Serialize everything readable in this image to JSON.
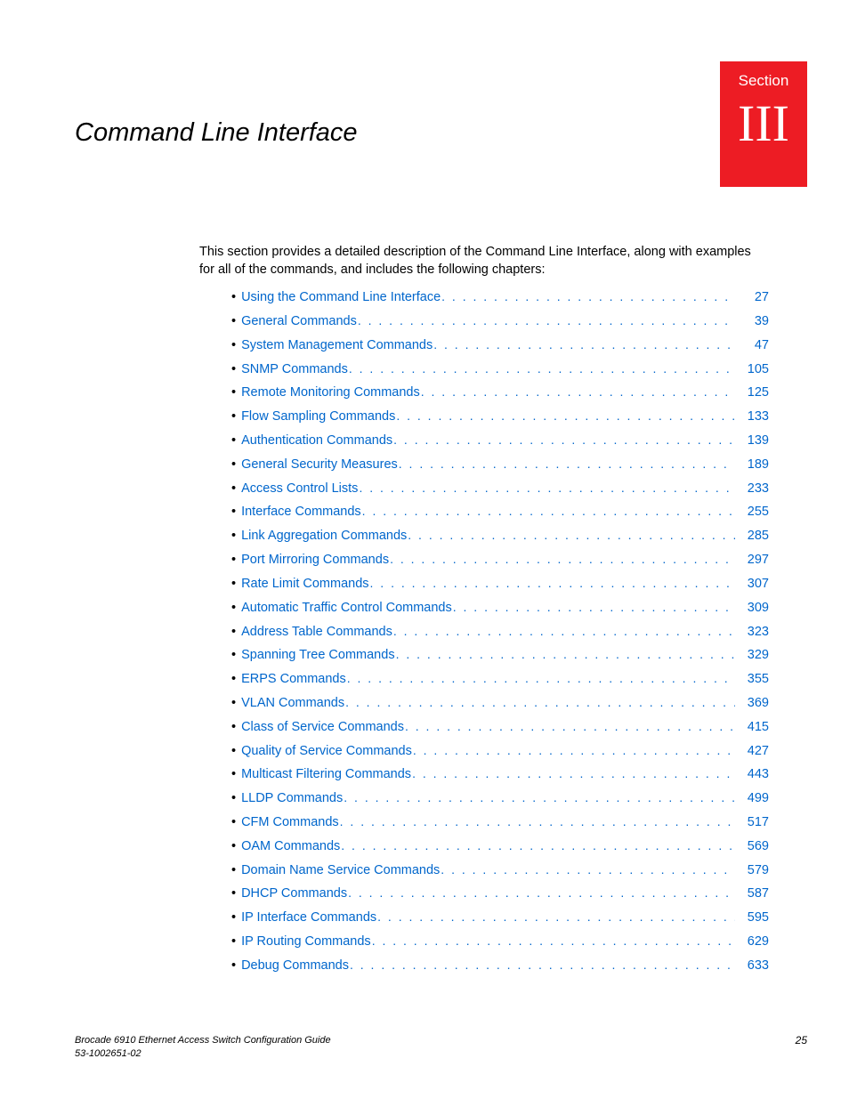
{
  "section": {
    "label": "Section",
    "number": "III"
  },
  "title": "Command Line Interface",
  "intro": "This section provides a detailed description of the Command Line Interface, along with examples for all of the commands, and includes the following chapters:",
  "toc": [
    {
      "label": "Using the Command Line Interface",
      "page": "27"
    },
    {
      "label": "General Commands",
      "page": "39"
    },
    {
      "label": "System Management Commands",
      "page": "47"
    },
    {
      "label": "SNMP Commands",
      "page": "105"
    },
    {
      "label": "Remote Monitoring Commands",
      "page": "125"
    },
    {
      "label": "Flow Sampling Commands",
      "page": "133"
    },
    {
      "label": "Authentication Commands",
      "page": "139"
    },
    {
      "label": "General Security Measures",
      "page": "189"
    },
    {
      "label": "Access Control Lists",
      "page": "233"
    },
    {
      "label": "Interface Commands",
      "page": "255"
    },
    {
      "label": "Link Aggregation Commands",
      "page": "285"
    },
    {
      "label": "Port Mirroring Commands",
      "page": "297"
    },
    {
      "label": "Rate Limit Commands",
      "page": "307"
    },
    {
      "label": "Automatic Traffic Control Commands",
      "page": "309"
    },
    {
      "label": "Address Table Commands",
      "page": "323"
    },
    {
      "label": "Spanning Tree Commands",
      "page": "329"
    },
    {
      "label": "ERPS Commands",
      "page": "355"
    },
    {
      "label": "VLAN Commands",
      "page": "369"
    },
    {
      "label": "Class of Service Commands",
      "page": "415"
    },
    {
      "label": "Quality of Service Commands",
      "page": "427"
    },
    {
      "label": "Multicast Filtering Commands",
      "page": "443"
    },
    {
      "label": "LLDP Commands",
      "page": "499"
    },
    {
      "label": "CFM Commands",
      "page": "517"
    },
    {
      "label": "OAM Commands",
      "page": "569"
    },
    {
      "label": "Domain Name Service Commands",
      "page": "579"
    },
    {
      "label": "DHCP Commands",
      "page": "587"
    },
    {
      "label": "IP Interface Commands",
      "page": "595"
    },
    {
      "label": "IP Routing Commands",
      "page": "629"
    },
    {
      "label": "Debug Commands",
      "page": "633"
    }
  ],
  "footer": {
    "guide": "Brocade 6910 Ethernet Access Switch Configuration Guide",
    "docnum": "53-1002651-02",
    "pagenum": "25"
  }
}
